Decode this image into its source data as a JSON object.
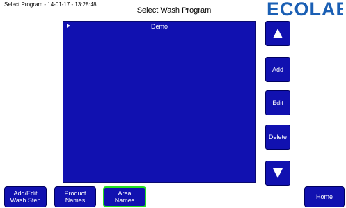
{
  "header": {
    "status_text": "Select Program - 14-01-17 - 13:28:48",
    "title": "Select Wash Program",
    "logo_text": "ECOLAB",
    "logo_color": "#1a5fb4"
  },
  "program_list": {
    "items": [
      {
        "label": "Demo",
        "selected": true
      }
    ],
    "background_color": "#1111b0"
  },
  "side_buttons": {
    "scroll_up_icon": "triangle-up-icon",
    "add_label": "Add",
    "edit_label": "Edit",
    "delete_label": "Delete",
    "scroll_down_icon": "triangle-down-icon"
  },
  "bottom_nav": {
    "add_edit_wash_step": {
      "line1": "Add/Edit",
      "line2": "Wash Step"
    },
    "product_names": {
      "line1": "Product",
      "line2": "Names"
    },
    "area_names": {
      "line1": "Area",
      "line2": "Names",
      "active": true
    },
    "home_label": "Home",
    "active_border_color": "#22dd22"
  }
}
